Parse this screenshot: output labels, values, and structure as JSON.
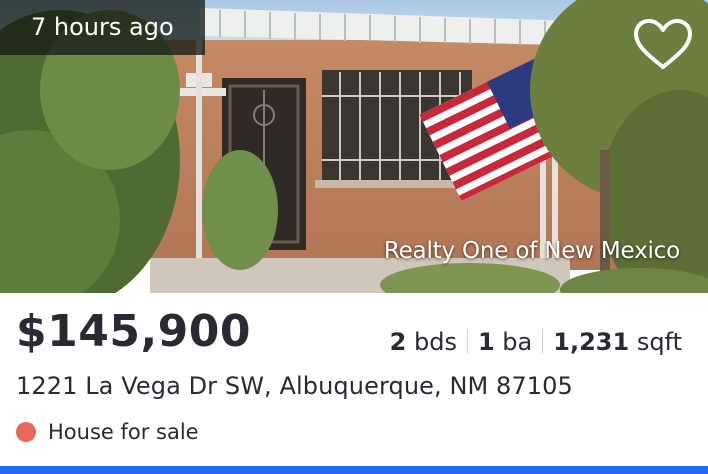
{
  "listing": {
    "time_ago": "7 hours ago",
    "brokerage": "Realty One of New Mexico",
    "price": "$145,900",
    "beds_value": "2",
    "beds_unit": "bds",
    "baths_value": "1",
    "baths_unit": "ba",
    "sqft_value": "1,231",
    "sqft_unit": "sqft",
    "address": "1221 La Vega Dr SW, Albuquerque, NM 87105",
    "status": "House for sale",
    "house_number": "1221"
  },
  "icons": {
    "favorite": "heart-outline-icon",
    "status_dot": "dot-icon"
  },
  "colors": {
    "status_dot": "#e8695a",
    "bottom_bar": "#1d6ff2",
    "text": "#2a2a33"
  }
}
